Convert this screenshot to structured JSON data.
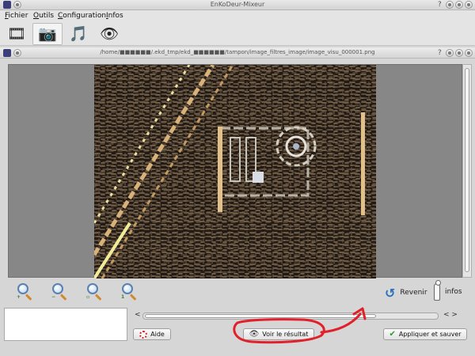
{
  "app": {
    "title": "EnKoDeur-Mixeur"
  },
  "menubar": {
    "items": [
      {
        "accel": "F",
        "rest": "ichier"
      },
      {
        "accel": "O",
        "rest": "utils"
      },
      {
        "accel": "C",
        "rest": "onfiguration"
      },
      {
        "accel": "I",
        "rest": "nfos"
      }
    ]
  },
  "toolbar": {
    "tabs": [
      {
        "icon": "film-reel-icon",
        "glyph": "🎞",
        "active": false
      },
      {
        "icon": "camera-icon",
        "glyph": "📷",
        "active": true
      },
      {
        "icon": "music-speaker-icon",
        "glyph": "🎵",
        "active": false
      },
      {
        "icon": "eye-icon",
        "glyph": "👁",
        "active": false
      }
    ]
  },
  "subwindow": {
    "title": "/home/■■■■■■/.ekd_tmp/ekd_■■■■■■/tampon/image_filtres_image/image_visu_000001.png"
  },
  "zoom": {
    "buttons": [
      {
        "icon": "zoom-in-icon",
        "mark": "+"
      },
      {
        "icon": "zoom-out-icon",
        "mark": "−"
      },
      {
        "icon": "zoom-fit-icon",
        "mark": "▫"
      },
      {
        "icon": "zoom-original-icon",
        "mark": "1"
      }
    ]
  },
  "actions": {
    "revert_label": "Revenir",
    "info_label": "infos"
  },
  "hscroll": {
    "left_arrow": "<",
    "right_arrows": "< >"
  },
  "buttons": {
    "help_label": "Aide",
    "preview_label": "Voir le résultat",
    "apply_label": "Appliquer et sauver"
  },
  "colors": {
    "annotation": "#e0202a",
    "accent": "#2a6fbf"
  }
}
